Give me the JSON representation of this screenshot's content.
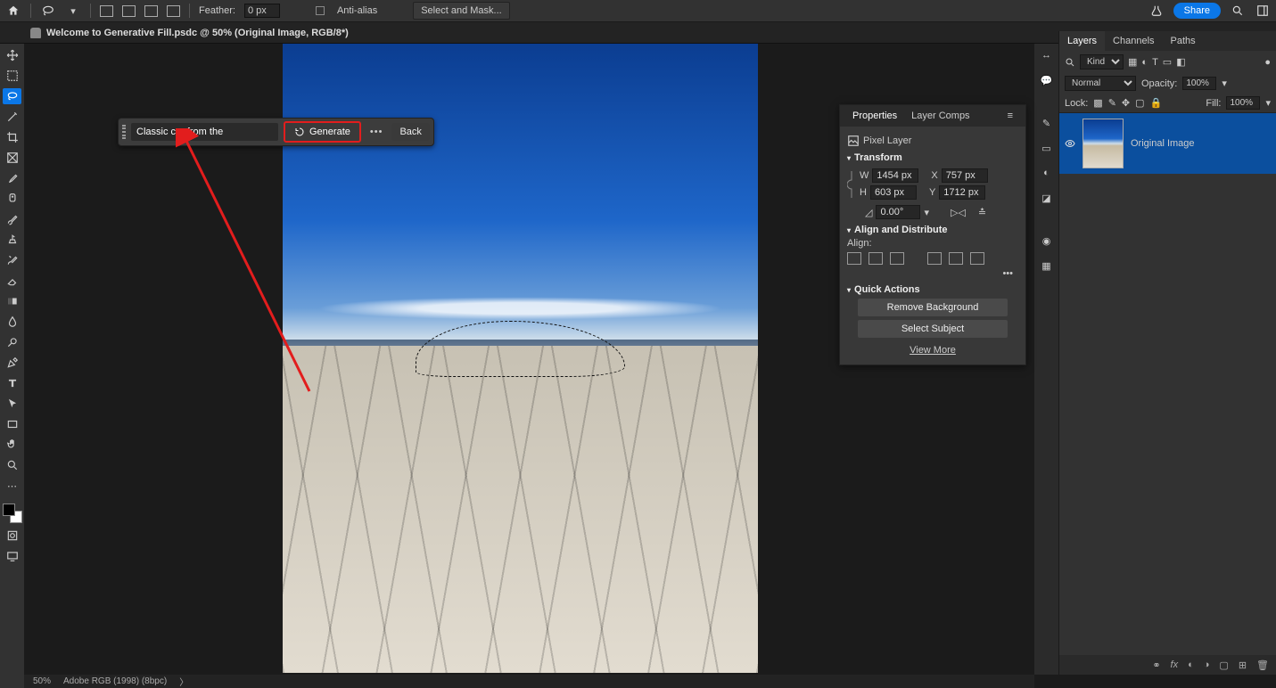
{
  "topbar": {
    "feather_label": "Feather:",
    "feather_value": "0 px",
    "anti_alias": "Anti-alias",
    "select_mask": "Select and Mask...",
    "share": "Share"
  },
  "doc_tab": {
    "title": "Welcome to Generative Fill.psdc @ 50% (Original Image, RGB/8*)"
  },
  "ctx_bar": {
    "prompt_value": "Classic car from the",
    "generate": "Generate",
    "back": "Back"
  },
  "properties": {
    "tab_properties": "Properties",
    "tab_layercomps": "Layer Comps",
    "layer_type": "Pixel Layer",
    "transform": "Transform",
    "w_label": "W",
    "w_val": "1454 px",
    "h_label": "H",
    "h_val": "603 px",
    "x_label": "X",
    "x_val": "757 px",
    "y_label": "Y",
    "y_val": "1712 px",
    "angle": "0.00°",
    "align_distribute": "Align and Distribute",
    "align_label": "Align:",
    "quick_actions": "Quick Actions",
    "remove_bg": "Remove Background",
    "select_subject": "Select Subject",
    "view_more": "View More"
  },
  "layers": {
    "tab_layers": "Layers",
    "tab_channels": "Channels",
    "tab_paths": "Paths",
    "filter_kind": "Kind",
    "blend_mode": "Normal",
    "opacity_label": "Opacity:",
    "opacity_val": "100%",
    "lock_label": "Lock:",
    "fill_label": "Fill:",
    "fill_val": "100%",
    "layer1_name": "Original Image"
  },
  "status": {
    "zoom": "50%",
    "profile": "Adobe RGB (1998) (8bpc)"
  }
}
